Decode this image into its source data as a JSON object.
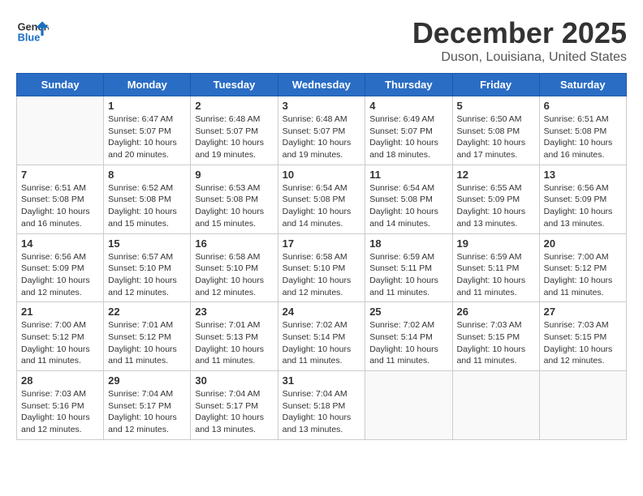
{
  "header": {
    "logo_line1": "General",
    "logo_line2": "Blue",
    "month_title": "December 2025",
    "location": "Duson, Louisiana, United States"
  },
  "weekdays": [
    "Sunday",
    "Monday",
    "Tuesday",
    "Wednesday",
    "Thursday",
    "Friday",
    "Saturday"
  ],
  "weeks": [
    [
      {
        "day": "",
        "info": ""
      },
      {
        "day": "1",
        "info": "Sunrise: 6:47 AM\nSunset: 5:07 PM\nDaylight: 10 hours\nand 20 minutes."
      },
      {
        "day": "2",
        "info": "Sunrise: 6:48 AM\nSunset: 5:07 PM\nDaylight: 10 hours\nand 19 minutes."
      },
      {
        "day": "3",
        "info": "Sunrise: 6:48 AM\nSunset: 5:07 PM\nDaylight: 10 hours\nand 19 minutes."
      },
      {
        "day": "4",
        "info": "Sunrise: 6:49 AM\nSunset: 5:07 PM\nDaylight: 10 hours\nand 18 minutes."
      },
      {
        "day": "5",
        "info": "Sunrise: 6:50 AM\nSunset: 5:08 PM\nDaylight: 10 hours\nand 17 minutes."
      },
      {
        "day": "6",
        "info": "Sunrise: 6:51 AM\nSunset: 5:08 PM\nDaylight: 10 hours\nand 16 minutes."
      }
    ],
    [
      {
        "day": "7",
        "info": "Sunrise: 6:51 AM\nSunset: 5:08 PM\nDaylight: 10 hours\nand 16 minutes."
      },
      {
        "day": "8",
        "info": "Sunrise: 6:52 AM\nSunset: 5:08 PM\nDaylight: 10 hours\nand 15 minutes."
      },
      {
        "day": "9",
        "info": "Sunrise: 6:53 AM\nSunset: 5:08 PM\nDaylight: 10 hours\nand 15 minutes."
      },
      {
        "day": "10",
        "info": "Sunrise: 6:54 AM\nSunset: 5:08 PM\nDaylight: 10 hours\nand 14 minutes."
      },
      {
        "day": "11",
        "info": "Sunrise: 6:54 AM\nSunset: 5:08 PM\nDaylight: 10 hours\nand 14 minutes."
      },
      {
        "day": "12",
        "info": "Sunrise: 6:55 AM\nSunset: 5:09 PM\nDaylight: 10 hours\nand 13 minutes."
      },
      {
        "day": "13",
        "info": "Sunrise: 6:56 AM\nSunset: 5:09 PM\nDaylight: 10 hours\nand 13 minutes."
      }
    ],
    [
      {
        "day": "14",
        "info": "Sunrise: 6:56 AM\nSunset: 5:09 PM\nDaylight: 10 hours\nand 12 minutes."
      },
      {
        "day": "15",
        "info": "Sunrise: 6:57 AM\nSunset: 5:10 PM\nDaylight: 10 hours\nand 12 minutes."
      },
      {
        "day": "16",
        "info": "Sunrise: 6:58 AM\nSunset: 5:10 PM\nDaylight: 10 hours\nand 12 minutes."
      },
      {
        "day": "17",
        "info": "Sunrise: 6:58 AM\nSunset: 5:10 PM\nDaylight: 10 hours\nand 12 minutes."
      },
      {
        "day": "18",
        "info": "Sunrise: 6:59 AM\nSunset: 5:11 PM\nDaylight: 10 hours\nand 11 minutes."
      },
      {
        "day": "19",
        "info": "Sunrise: 6:59 AM\nSunset: 5:11 PM\nDaylight: 10 hours\nand 11 minutes."
      },
      {
        "day": "20",
        "info": "Sunrise: 7:00 AM\nSunset: 5:12 PM\nDaylight: 10 hours\nand 11 minutes."
      }
    ],
    [
      {
        "day": "21",
        "info": "Sunrise: 7:00 AM\nSunset: 5:12 PM\nDaylight: 10 hours\nand 11 minutes."
      },
      {
        "day": "22",
        "info": "Sunrise: 7:01 AM\nSunset: 5:12 PM\nDaylight: 10 hours\nand 11 minutes."
      },
      {
        "day": "23",
        "info": "Sunrise: 7:01 AM\nSunset: 5:13 PM\nDaylight: 10 hours\nand 11 minutes."
      },
      {
        "day": "24",
        "info": "Sunrise: 7:02 AM\nSunset: 5:14 PM\nDaylight: 10 hours\nand 11 minutes."
      },
      {
        "day": "25",
        "info": "Sunrise: 7:02 AM\nSunset: 5:14 PM\nDaylight: 10 hours\nand 11 minutes."
      },
      {
        "day": "26",
        "info": "Sunrise: 7:03 AM\nSunset: 5:15 PM\nDaylight: 10 hours\nand 11 minutes."
      },
      {
        "day": "27",
        "info": "Sunrise: 7:03 AM\nSunset: 5:15 PM\nDaylight: 10 hours\nand 12 minutes."
      }
    ],
    [
      {
        "day": "28",
        "info": "Sunrise: 7:03 AM\nSunset: 5:16 PM\nDaylight: 10 hours\nand 12 minutes."
      },
      {
        "day": "29",
        "info": "Sunrise: 7:04 AM\nSunset: 5:17 PM\nDaylight: 10 hours\nand 12 minutes."
      },
      {
        "day": "30",
        "info": "Sunrise: 7:04 AM\nSunset: 5:17 PM\nDaylight: 10 hours\nand 13 minutes."
      },
      {
        "day": "31",
        "info": "Sunrise: 7:04 AM\nSunset: 5:18 PM\nDaylight: 10 hours\nand 13 minutes."
      },
      {
        "day": "",
        "info": ""
      },
      {
        "day": "",
        "info": ""
      },
      {
        "day": "",
        "info": ""
      }
    ]
  ]
}
